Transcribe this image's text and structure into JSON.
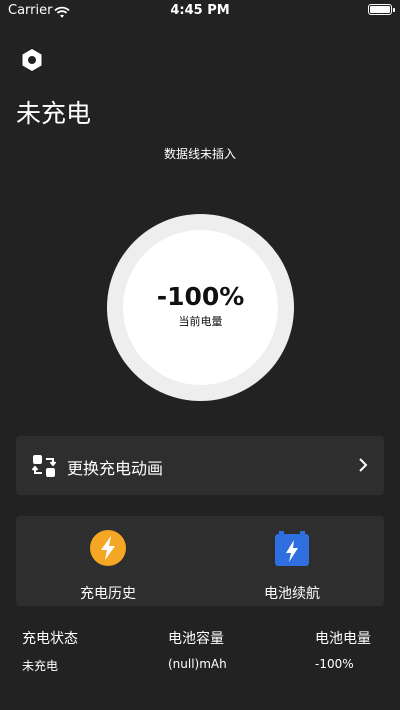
{
  "status_bar": {
    "carrier": "Carrier",
    "time": "4:45 PM"
  },
  "header": {
    "title": "未充电",
    "cable_status": "数据线未插入"
  },
  "gauge": {
    "percent_text": "-100%",
    "label": "当前电量"
  },
  "animation_row": {
    "label": "更换充电动画"
  },
  "features": [
    {
      "label": "充电历史",
      "color": "#f5a623"
    },
    {
      "label": "电池续航",
      "color": "#2f6fe0"
    }
  ],
  "stats": [
    {
      "title": "充电状态",
      "value": "未充电"
    },
    {
      "title": "电池容量",
      "value": "(null)mAh"
    },
    {
      "title": "电池电量",
      "value": "-100%"
    }
  ],
  "colors": {
    "background": "#222222",
    "card": "#2e2e2e",
    "ring": "#eeeeee"
  }
}
